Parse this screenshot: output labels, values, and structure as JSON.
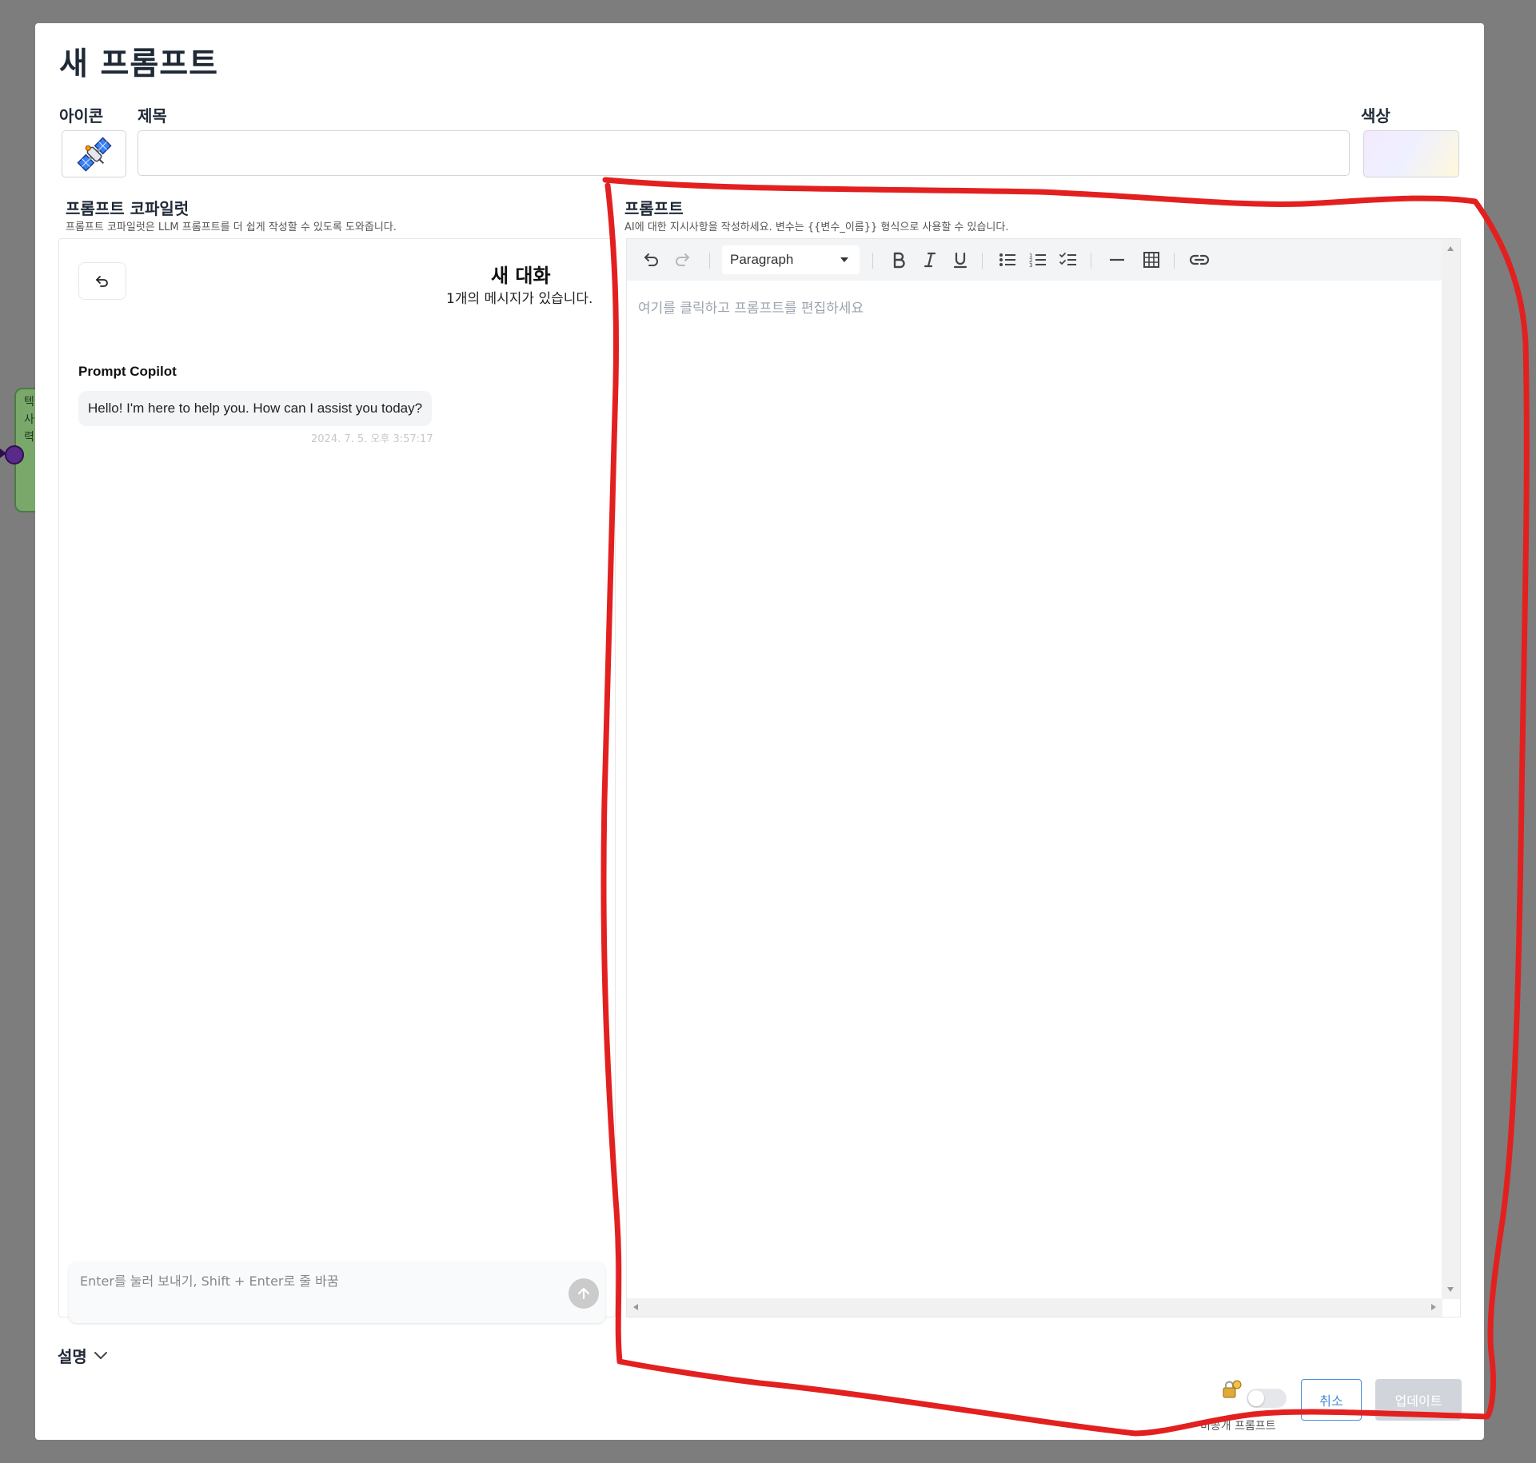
{
  "background": {
    "node_text_lines": [
      "텍",
      "사",
      "력"
    ]
  },
  "modal": {
    "title": "새 프롬프트",
    "icon_label": "아이콘",
    "title_label": "제목",
    "title_value": "",
    "color_label": "색상",
    "icon_name": "satellite-icon"
  },
  "copilot": {
    "title": "프롬프트 코파일럿",
    "subtitle": "프롬프트 코파일럿은 LLM 프롬프트를 더 쉽게 작성할 수 있도록 도와줍니다.",
    "conversation_title": "새 대화",
    "conversation_count": "1개의 메시지가 있습니다.",
    "messages": [
      {
        "sender": "Prompt Copilot",
        "text": "Hello! I'm here to help you. How can I assist you today?",
        "time": "2024. 7. 5. 오후 3:57:17"
      }
    ],
    "input_placeholder": "Enter를 눌러 보내기, Shift + Enter로 줄 바꿈"
  },
  "prompt": {
    "title": "프롬프트",
    "subtitle": "AI에 대한 지시사항을 작성하세요. 변수는 {{변수_이름}} 형식으로 사용할 수 있습니다.",
    "block_type": "Paragraph",
    "placeholder": "여기를 클릭하고 프롬프트를 편집하세요",
    "toolbar_icons": [
      "undo-icon",
      "redo-icon",
      "bold-icon",
      "italic-icon",
      "underline-icon",
      "bullet-list-icon",
      "numbered-list-icon",
      "checklist-icon",
      "horizontal-rule-icon",
      "table-icon",
      "link-icon"
    ]
  },
  "footer": {
    "description_label": "설명",
    "private_label": "비공개 프롬프트",
    "private_enabled": false,
    "cancel_label": "취소",
    "update_label": "업데이트"
  },
  "colors": {
    "annotation": "#e32020",
    "accent": "#4a90d9",
    "disabled": "#d1d5db"
  }
}
